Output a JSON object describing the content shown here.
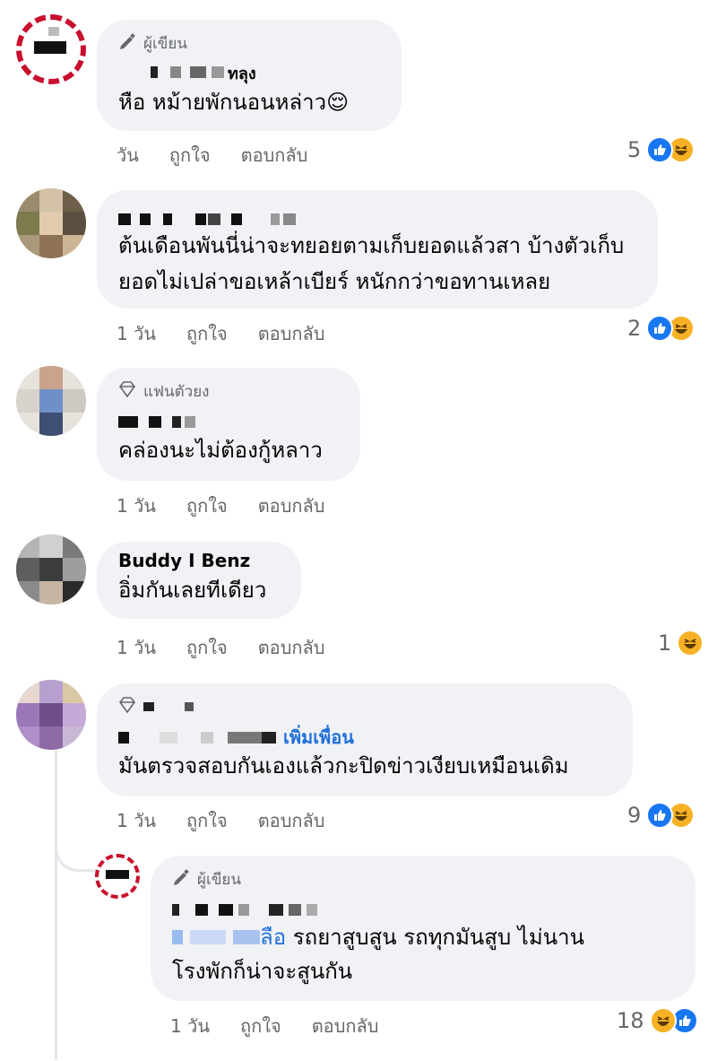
{
  "comments": [
    {
      "badge": "ผู้เขียน",
      "name": "ทลุง",
      "text": "หือ หม้ายพักนอนหล่าว😌",
      "time": "วัน",
      "like": "ถูกใจ",
      "reply": "ตอบกลับ",
      "react_count": "5"
    },
    {
      "text": "ต้นเดือนพันนี่น่าจะทยอยตามเก็บยอดแล้วสา บ้างตัวเก็บยอดไม่เปล่าขอเหล้าเบียร์ หนักกว่าขอทานเหลย",
      "time": "1 วัน",
      "like": "ถูกใจ",
      "reply": "ตอบกลับ",
      "react_count": "2"
    },
    {
      "badge": "แฟนตัวยง",
      "text": "คล่องนะไม่ต้องกู้หลาว",
      "time": "1 วัน",
      "like": "ถูกใจ",
      "reply": "ตอบกลับ"
    },
    {
      "name": "Buddy I Benz",
      "text": "อิ่มกันเลยทีเดียว",
      "time": "1 วัน",
      "like": "ถูกใจ",
      "reply": "ตอบกลับ",
      "react_count": "1"
    },
    {
      "add_friend": "เพิ่มเพื่อน",
      "text": "มันตรวจสอบกันเองแล้วกะปิดข่าวเงียบเหมือนเดิม",
      "time": "1 วัน",
      "like": "ถูกใจ",
      "reply": "ตอบกลับ",
      "react_count": "9"
    }
  ],
  "reply": {
    "badge": "ผู้เขียน",
    "mention": "ลือ",
    "text_line1": "รถยาสูบสูน  รถทุกมันสูบ  ไม่นาน",
    "text_line2": "โรงพักก็น่าจะสูนกัน",
    "time": "1 วัน",
    "like": "ถูกใจ",
    "reply": "ตอบกลับ",
    "react_count": "18"
  },
  "colors": {
    "bubble": "#f0f2f5",
    "meta_text": "#65676b",
    "link": "#216fdb",
    "like_blue": "#1877f2",
    "haha_yellow": "#f7b125"
  },
  "icons": [
    "pen-icon",
    "diamond-icon",
    "like-reaction-icon",
    "haha-reaction-icon"
  ]
}
